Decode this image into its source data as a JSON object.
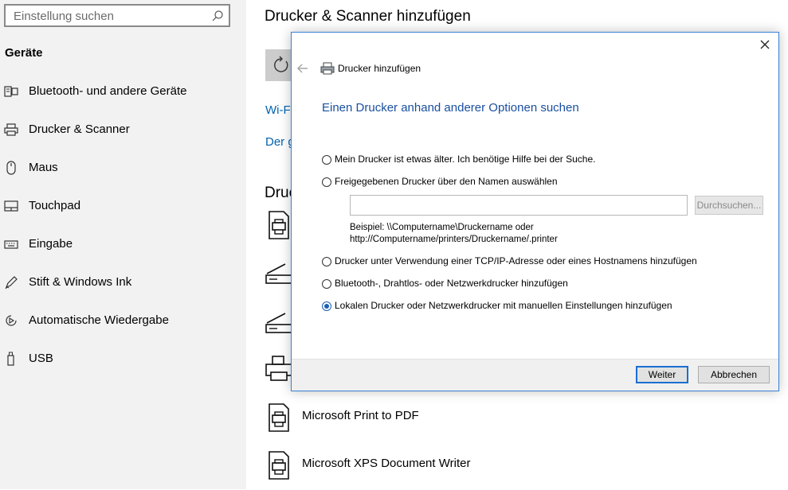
{
  "sidebar": {
    "search_placeholder": "Einstellung suchen",
    "section_title": "Geräte",
    "items": [
      {
        "label": "Bluetooth- und andere Geräte",
        "icon": "bluetooth-devices-icon"
      },
      {
        "label": "Drucker & Scanner",
        "icon": "printer-icon"
      },
      {
        "label": "Maus",
        "icon": "mouse-icon"
      },
      {
        "label": "Touchpad",
        "icon": "touchpad-icon"
      },
      {
        "label": "Eingabe",
        "icon": "keyboard-icon"
      },
      {
        "label": "Stift & Windows Ink",
        "icon": "pen-icon"
      },
      {
        "label": "Automatische Wiedergabe",
        "icon": "autoplay-icon"
      },
      {
        "label": "USB",
        "icon": "usb-icon"
      }
    ]
  },
  "main": {
    "title": "Drucker & Scanner hinzufügen",
    "link1": "Wi-F",
    "link2": "Der g",
    "list_heading": "Druc",
    "devices": [
      {
        "label": "",
        "icon": "printer-icon"
      },
      {
        "label": "",
        "icon": "scanner-icon"
      },
      {
        "label": "",
        "icon": "scanner-icon"
      },
      {
        "label": "",
        "icon": "fax-icon"
      },
      {
        "label": "Microsoft Print to PDF",
        "icon": "printer-icon"
      },
      {
        "label": "Microsoft XPS Document Writer",
        "icon": "printer-icon"
      }
    ]
  },
  "dialog": {
    "title": "Drucker hinzufügen",
    "heading": "Einen Drucker anhand anderer Optionen suchen",
    "options": [
      {
        "label": "Mein Drucker ist etwas älter. Ich benötige Hilfe bei der Suche.",
        "checked": false
      },
      {
        "label": "Freigegebenen Drucker über den Namen auswählen",
        "checked": false
      },
      {
        "label": "Drucker unter Verwendung einer TCP/IP-Adresse oder eines Hostnamens hinzufügen",
        "checked": false
      },
      {
        "label": "Bluetooth-, Drahtlos- oder Netzwerkdrucker hinzufügen",
        "checked": false
      },
      {
        "label": "Lokalen Drucker oder Netzwerkdrucker mit manuellen Einstellungen hinzufügen",
        "checked": true
      }
    ],
    "name_input_value": "",
    "browse_label": "Durchsuchen...",
    "example_line1": "Beispiel: \\\\Computername\\Druckername oder",
    "example_line2": "http://Computername/printers/Druckername/.printer",
    "next_label": "Weiter",
    "cancel_label": "Abbrechen"
  },
  "colors": {
    "accent": "#0063b1",
    "dialog_border": "#3a80d4",
    "heading_blue": "#1a4fa0",
    "sidebar_bg": "#f2f2f2"
  }
}
